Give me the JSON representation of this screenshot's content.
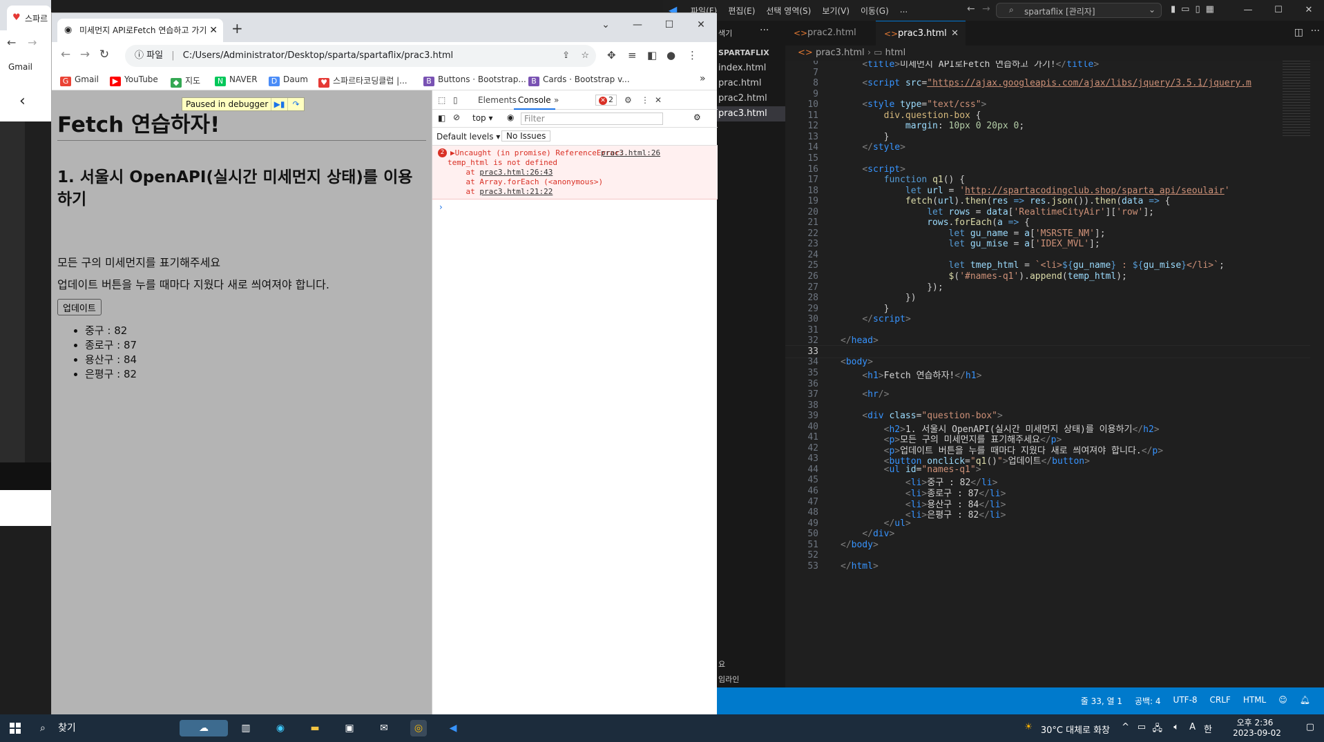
{
  "background_app": {
    "tab_title": "스파르"
  },
  "chrome": {
    "tab_title": "미세먼지 API로Fetch 연습하고 가기",
    "address": {
      "scheme_label": "파일",
      "url": "C:/Users/Administrator/Desktop/sparta/spartaflix/prac3.html"
    },
    "bookmarks": [
      {
        "label": "Gmail",
        "color": "#ea4335",
        "glyph": "G"
      },
      {
        "label": "YouTube",
        "color": "#ff0000",
        "glyph": "▶"
      },
      {
        "label": "지도",
        "color": "#34a853",
        "glyph": "◆"
      },
      {
        "label": "NAVER",
        "color": "#03c75a",
        "glyph": "N"
      },
      {
        "label": "Daum",
        "color": "#4a8cf7",
        "glyph": "D"
      },
      {
        "label": "스파르타코딩클럽 |...",
        "color": "#e53935",
        "glyph": "♥"
      },
      {
        "label": "Buttons · Bootstrap...",
        "color": "#7952b3",
        "glyph": "B"
      },
      {
        "label": "Cards · Bootstrap v...",
        "color": "#7952b3",
        "glyph": "B"
      }
    ],
    "more_bookmarks": "»",
    "paused_label": "Paused in debugger",
    "page": {
      "h1": "Fetch 연습하자!",
      "h2": "1. 서울시 OpenAPI(실시간 미세먼지 상태)를 이용하기",
      "p1": "모든 구의 미세먼지를 표기해주세요",
      "p2": "업데이트 버튼을 누를 때마다 지웠다 새로 씌여져야 합니다.",
      "button": "업데이트",
      "list": [
        "중구 : 82",
        "종로구 : 87",
        "용산구 : 84",
        "은평구 : 82"
      ]
    },
    "devtools": {
      "tabs": [
        "Elements",
        "Console"
      ],
      "error_count": "2",
      "context": "top",
      "filter_placeholder": "Filter",
      "levels": "Default levels",
      "issues": "No Issues",
      "error": {
        "count": "2",
        "line1": "Uncaught (in promise) ReferenceError:",
        "link1": "prac3.html:26",
        "line2": "temp_html is not defined",
        "stack1_pre": "    at ",
        "stack1": "prac3.html:26:43",
        "stack2": "    at Array.forEach (<anonymous>)",
        "stack3_pre": "    at ",
        "stack3": "prac3.html:21:22"
      }
    }
  },
  "vscode": {
    "menu": [
      "파일(F)",
      "편집(E)",
      "선택 영역(S)",
      "보기(V)",
      "이동(G)",
      "..."
    ],
    "search": "spartaflix [관리자]",
    "explorer_header": "SPARTAFLIX",
    "explorer_files": [
      "index.html",
      "prac.html",
      "prac2.html",
      "prac3.html"
    ],
    "sidebar_bottom": [
      "요",
      "임라인"
    ],
    "explorer_top_label": "색기",
    "tabs": [
      "prac2.html",
      "prac3.html"
    ],
    "breadcrumb": [
      "prac3.html",
      "html"
    ],
    "status": [
      "줄 33, 열 1",
      "공백: 4",
      "UTF-8",
      "CRLF",
      "HTML"
    ],
    "code_lines": [
      {
        "n": "6",
        "html": "    <span class='t-br'>&lt;</span><span class='t-tag'>title</span><span class='t-br'>&gt;</span><span class='t-txt'>미세먼지 API로Fetch 연습하고 가기!</span><span class='t-br'>&lt;/</span><span class='t-tag'>title</span><span class='t-br'>&gt;</span>"
      },
      {
        "n": "7",
        "html": ""
      },
      {
        "n": "8",
        "html": "    <span class='t-br'>&lt;</span><span class='t-tag'>script</span> <span class='t-attr'>src</span>=<span class='t-url'>\"https://ajax.googleapis.com/ajax/libs/jquery/3.5.1/jquery.m</span>"
      },
      {
        "n": "9",
        "html": ""
      },
      {
        "n": "10",
        "html": "    <span class='t-br'>&lt;</span><span class='t-tag'>style</span> <span class='t-attr'>type</span>=<span class='t-str'>\"text/css\"</span><span class='t-br'>&gt;</span>"
      },
      {
        "n": "11",
        "html": "        <span class='t-sel'>div.question-box</span> {"
      },
      {
        "n": "12",
        "html": "            <span class='t-prop'>margin</span>: <span class='t-num'>10px</span> <span class='t-num'>0</span> <span class='t-num'>20px</span> <span class='t-num'>0</span>;"
      },
      {
        "n": "13",
        "html": "        }"
      },
      {
        "n": "14",
        "html": "    <span class='t-br'>&lt;/</span><span class='t-tag'>style</span><span class='t-br'>&gt;</span>"
      },
      {
        "n": "15",
        "html": ""
      },
      {
        "n": "16",
        "html": "    <span class='t-br'>&lt;</span><span class='t-tag'>script</span><span class='t-br'>&gt;</span>"
      },
      {
        "n": "17",
        "html": "        <span class='t-kw'>function</span> <span class='t-fn'>q1</span>() {"
      },
      {
        "n": "18",
        "html": "            <span class='t-kw'>let</span> <span class='t-var'>url</span> = <span class='t-str'>'</span><span class='t-url'>http://spartacodingclub.shop/sparta_api/seoulair</span><span class='t-str'>'</span>"
      },
      {
        "n": "19",
        "html": "            <span class='t-fn'>fetch</span>(<span class='t-var'>url</span>).<span class='t-fn'>then</span>(<span class='t-var'>res</span> <span class='t-kw'>=&gt;</span> <span class='t-var'>res</span>.<span class='t-fn'>json</span>()).<span class='t-fn'>then</span>(<span class='t-var'>data</span> <span class='t-kw'>=&gt;</span> {"
      },
      {
        "n": "20",
        "html": "                <span class='t-kw'>let</span> <span class='t-var'>rows</span> = <span class='t-var'>data</span>[<span class='t-str'>'RealtimeCityAir'</span>][<span class='t-str'>'row'</span>];"
      },
      {
        "n": "21",
        "html": "                <span class='t-var'>rows</span>.<span class='t-fn'>forEach</span>(<span class='t-var'>a</span> <span class='t-kw'>=&gt;</span> {"
      },
      {
        "n": "22",
        "html": "                    <span class='t-kw'>let</span> <span class='t-var'>gu_name</span> = <span class='t-var'>a</span>[<span class='t-str'>'MSRSTE_NM'</span>];"
      },
      {
        "n": "23",
        "html": "                    <span class='t-kw'>let</span> <span class='t-var'>gu_mise</span> = <span class='t-var'>a</span>[<span class='t-str'>'IDEX_MVL'</span>];"
      },
      {
        "n": "24",
        "html": ""
      },
      {
        "n": "25",
        "html": "                    <span class='t-kw'>let</span> <span class='t-var'>tmep_html</span> = <span class='t-str'>`&lt;li&gt;</span><span class='t-kw'>${</span><span class='t-var'>gu_name</span><span class='t-kw'>}</span><span class='t-str'> : </span><span class='t-kw'>${</span><span class='t-var'>gu_mise</span><span class='t-kw'>}</span><span class='t-str'>&lt;/li&gt;`</span>;"
      },
      {
        "n": "26",
        "html": "                    <span class='t-fn'>$</span>(<span class='t-str'>'#names-q1'</span>).<span class='t-fn'>append</span>(<span class='t-var'>temp_html</span>);"
      },
      {
        "n": "27",
        "html": "                });"
      },
      {
        "n": "28",
        "html": "            })"
      },
      {
        "n": "29",
        "html": "        }"
      },
      {
        "n": "30",
        "html": "    <span class='t-br'>&lt;/</span><span class='t-tag'>script</span><span class='t-br'>&gt;</span>"
      },
      {
        "n": "31",
        "html": ""
      },
      {
        "n": "32",
        "html": "<span class='t-br'>&lt;/</span><span class='t-tag'>head</span><span class='t-br'>&gt;</span>"
      },
      {
        "n": "33",
        "html": ""
      },
      {
        "n": "34",
        "html": "<span class='t-br'>&lt;</span><span class='t-tag'>body</span><span class='t-br'>&gt;</span>"
      },
      {
        "n": "35",
        "html": "    <span class='t-br'>&lt;</span><span class='t-tag'>h1</span><span class='t-br'>&gt;</span><span class='t-txt'>Fetch 연습하자!</span><span class='t-br'>&lt;/</span><span class='t-tag'>h1</span><span class='t-br'>&gt;</span>"
      },
      {
        "n": "36",
        "html": ""
      },
      {
        "n": "37",
        "html": "    <span class='t-br'>&lt;</span><span class='t-tag'>hr</span><span class='t-br'>/&gt;</span>"
      },
      {
        "n": "38",
        "html": ""
      },
      {
        "n": "39",
        "html": "    <span class='t-br'>&lt;</span><span class='t-tag'>div</span> <span class='t-attr'>class</span>=<span class='t-str'>\"question-box\"</span><span class='t-br'>&gt;</span>"
      },
      {
        "n": "40",
        "html": "        <span class='t-br'>&lt;</span><span class='t-tag'>h2</span><span class='t-br'>&gt;</span><span class='t-txt'>1. 서울시 OpenAPI(실시간 미세먼지 상태)를 이용하기</span><span class='t-br'>&lt;/</span><span class='t-tag'>h2</span><span class='t-br'>&gt;</span>"
      },
      {
        "n": "41",
        "html": "        <span class='t-br'>&lt;</span><span class='t-tag'>p</span><span class='t-br'>&gt;</span><span class='t-txt'>모든 구의 미세먼지를 표기해주세요</span><span class='t-br'>&lt;/</span><span class='t-tag'>p</span><span class='t-br'>&gt;</span>"
      },
      {
        "n": "42",
        "html": "        <span class='t-br'>&lt;</span><span class='t-tag'>p</span><span class='t-br'>&gt;</span><span class='t-txt'>업데이트 버튼을 누를 때마다 지웠다 새로 씌여져야 합니다.</span><span class='t-br'>&lt;/</span><span class='t-tag'>p</span><span class='t-br'>&gt;</span>"
      },
      {
        "n": "43",
        "html": "        <span class='t-br'>&lt;</span><span class='t-tag'>button</span> <span class='t-attr'>onclick</span>=<span class='t-str'>\"</span><span class='t-fn'>q1</span>()<span class='t-str'>\"</span><span class='t-br'>&gt;</span><span class='t-txt'>업데이트</span><span class='t-br'>&lt;/</span><span class='t-tag'>button</span><span class='t-br'>&gt;</span>"
      },
      {
        "n": "44",
        "html": "        <span class='t-br'>&lt;</span><span class='t-tag'>ul</span> <span class='t-attr'>id</span>=<span class='t-str'>\"names-q1\"</span><span class='t-br'>&gt;</span>"
      },
      {
        "n": "45",
        "html": "            <span class='t-br'>&lt;</span><span class='t-tag'>li</span><span class='t-br'>&gt;</span><span class='t-txt'>중구 : 82</span><span class='t-br'>&lt;/</span><span class='t-tag'>li</span><span class='t-br'>&gt;</span>"
      },
      {
        "n": "46",
        "html": "            <span class='t-br'>&lt;</span><span class='t-tag'>li</span><span class='t-br'>&gt;</span><span class='t-txt'>종로구 : 87</span><span class='t-br'>&lt;/</span><span class='t-tag'>li</span><span class='t-br'>&gt;</span>"
      },
      {
        "n": "47",
        "html": "            <span class='t-br'>&lt;</span><span class='t-tag'>li</span><span class='t-br'>&gt;</span><span class='t-txt'>용산구 : 84</span><span class='t-br'>&lt;/</span><span class='t-tag'>li</span><span class='t-br'>&gt;</span>"
      },
      {
        "n": "48",
        "html": "            <span class='t-br'>&lt;</span><span class='t-tag'>li</span><span class='t-br'>&gt;</span><span class='t-txt'>은평구 : 82</span><span class='t-br'>&lt;/</span><span class='t-tag'>li</span><span class='t-br'>&gt;</span>"
      },
      {
        "n": "49",
        "html": "        <span class='t-br'>&lt;/</span><span class='t-tag'>ul</span><span class='t-br'>&gt;</span>"
      },
      {
        "n": "50",
        "html": "    <span class='t-br'>&lt;/</span><span class='t-tag'>div</span><span class='t-br'>&gt;</span>"
      },
      {
        "n": "51",
        "html": "<span class='t-br'>&lt;/</span><span class='t-tag'>body</span><span class='t-br'>&gt;</span>"
      },
      {
        "n": "52",
        "html": ""
      },
      {
        "n": "53",
        "html": "<span class='t-br'>&lt;/</span><span class='t-tag'>html</span><span class='t-br'>&gt;</span>"
      }
    ],
    "current_line": "33"
  },
  "taskbar": {
    "search": "찾기",
    "weather": "30°C  대체로 화창",
    "ime": "A",
    "ime2": "한",
    "time": "오후 2:36",
    "date": "2023-09-02"
  }
}
